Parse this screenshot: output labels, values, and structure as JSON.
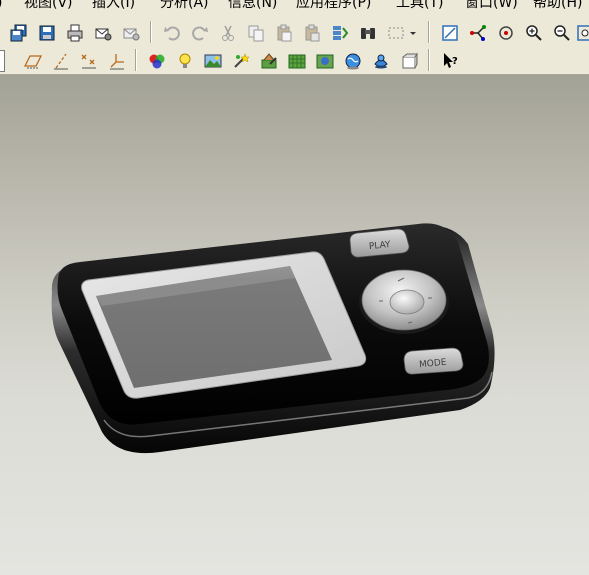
{
  "menu": {
    "items": [
      {
        "id": "partial",
        "label": ")"
      },
      {
        "id": "view",
        "label": "视图(V)"
      },
      {
        "id": "insert",
        "label": "插入(I)"
      },
      {
        "id": "analysis",
        "label": "分析(A)"
      },
      {
        "id": "info",
        "label": "信息(N)"
      },
      {
        "id": "applications",
        "label": "应用程序(P)"
      },
      {
        "id": "tools",
        "label": "工具(T)"
      },
      {
        "id": "window",
        "label": "窗口(W)"
      },
      {
        "id": "help",
        "label": "帮助(H)"
      }
    ]
  },
  "toolbar_row1": {
    "icons": [
      "save-copy-icon",
      "save-icon",
      "print-icon",
      "send-mail-icon",
      "send-mail-2-icon",
      "undo-icon",
      "redo-icon",
      "cut-icon",
      "copy-icon",
      "paste-icon",
      "paste-special-icon",
      "regenerate-icon",
      "find-icon",
      "select-box-icon",
      "dropdown-icon",
      "sketch-view-icon",
      "orient-icon",
      "spin-center-icon",
      "zoom-in-icon",
      "zoom-out-icon",
      "refit-icon"
    ]
  },
  "toolbar_row2": {
    "icons": [
      "datum-planes-icon",
      "datum-axes-icon",
      "datum-points-icon",
      "coord-sys-icon",
      "color-appearance-icon",
      "light-icon",
      "scene-icon",
      "effects-icon",
      "model-setup-icon",
      "texture-icon",
      "render-region-icon",
      "globe-icon",
      "person-icon",
      "teapot-icon",
      "cube-icon",
      "help-cursor-icon"
    ]
  },
  "device": {
    "top_button_label": "PLAY",
    "mode_button_label": "MODE"
  },
  "colors": {
    "toolbar_bg": "#ece9d8",
    "viewport_top": "#a3a297",
    "viewport_bottom": "#e4e4e0",
    "device_body": "#0b0b0b",
    "screen": "#7b7b7b"
  }
}
